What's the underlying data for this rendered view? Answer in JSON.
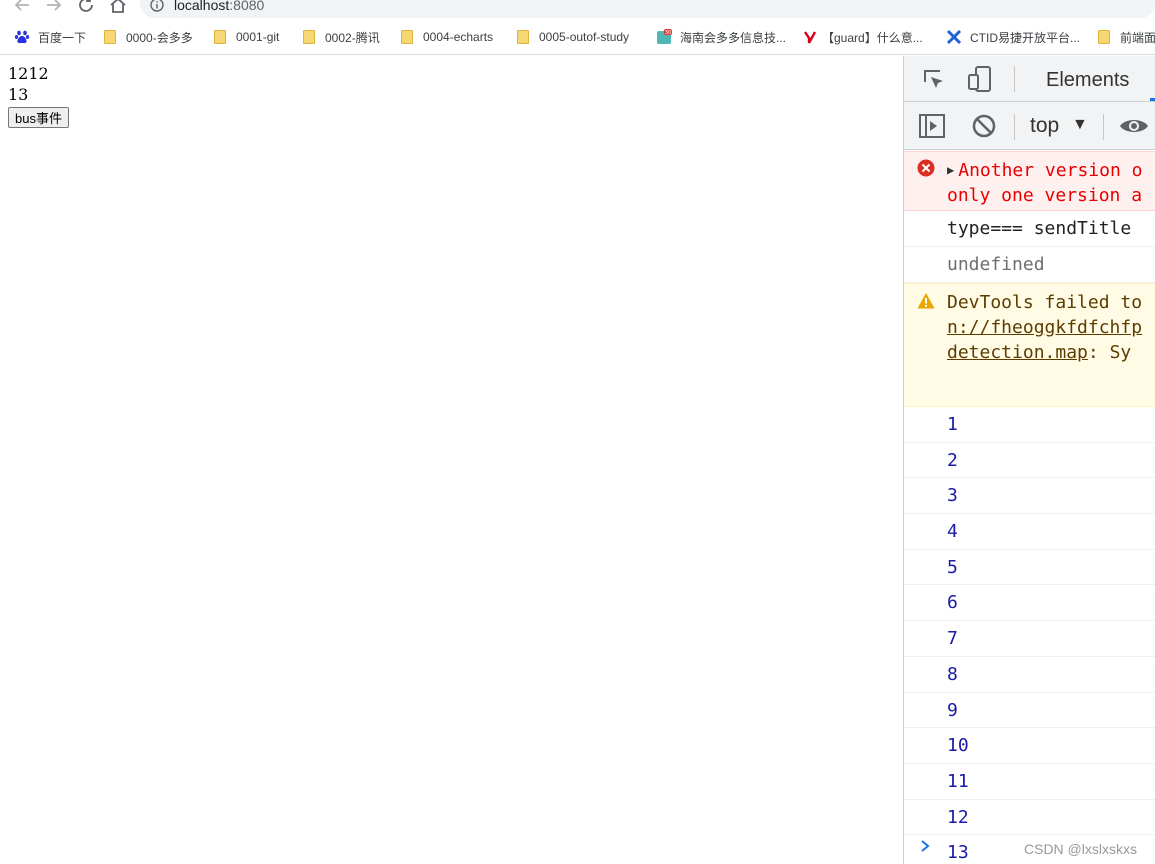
{
  "browser": {
    "url_host": "localhost",
    "url_port": ":8080",
    "bookmarks": [
      {
        "label": "百度一下",
        "icon": "baidu-paw-icon"
      },
      {
        "label": "0000-会多多",
        "icon": "folder-icon"
      },
      {
        "label": "0001-git",
        "icon": "folder-icon"
      },
      {
        "label": "0002-腾讯",
        "icon": "folder-icon"
      },
      {
        "label": "0004-echarts",
        "icon": "folder-icon"
      },
      {
        "label": "0005-outof-study",
        "icon": "folder-icon"
      },
      {
        "label": "海南会多多信息技...",
        "icon": "calendar-30-icon"
      },
      {
        "label": "【guard】什么意...",
        "icon": "youdao-y-icon"
      },
      {
        "label": "CTID易捷开放平台...",
        "icon": "ctid-cross-icon"
      },
      {
        "label": "前端面",
        "icon": "folder-icon"
      }
    ]
  },
  "page": {
    "line1": "1212",
    "line2": "13",
    "button_label": "bus事件"
  },
  "devtools": {
    "tab_label": "Elements",
    "context_label": "top",
    "context_arrow": "▼",
    "error_line1": "Another version o",
    "error_line2": "only one version a",
    "log_type": "type=== sendTitle",
    "log_undefined": "undefined",
    "warn_line1": "DevTools failed to",
    "warn_line2": "n://fheoggkfdfchfp",
    "warn_line3_link": " detection.map",
    "warn_line3_rest": ": Sy",
    "numbers": [
      "1",
      "2",
      "3",
      "4",
      "5",
      "6",
      "7",
      "8",
      "9",
      "10",
      "11",
      "12",
      "13"
    ],
    "prompt_symbol": ">",
    "watermark": "CSDN @lxslxskxs"
  },
  "colors": {
    "error_text": "#e80000",
    "number_text": "#1a1aa6",
    "warning_icon": "#e8a600",
    "error_icon": "#d93025",
    "prompt": "#1a73e8"
  }
}
